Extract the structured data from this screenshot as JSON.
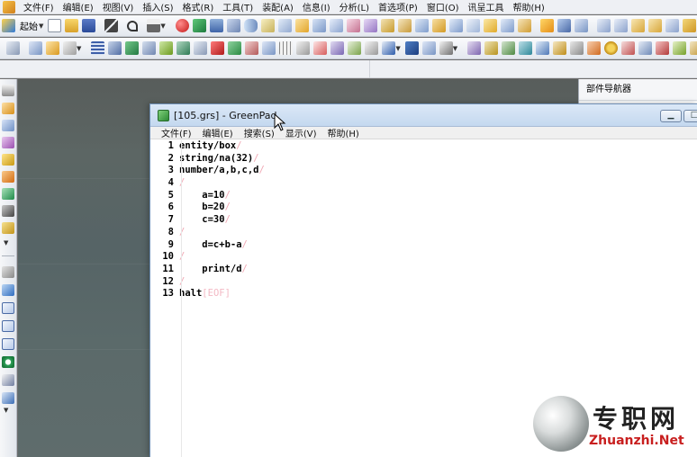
{
  "app": {
    "menu": [
      "文件(F)",
      "编辑(E)",
      "视图(V)",
      "插入(S)",
      "格式(R)",
      "工具(T)",
      "装配(A)",
      "信息(I)",
      "分析(L)",
      "首选项(P)",
      "窗口(O)",
      "讯呈工具",
      "帮助(H)"
    ]
  },
  "toolbar1": {
    "start_label": "起始"
  },
  "right_panel": {
    "title": "部件导航器"
  },
  "greenpad": {
    "title": "[105.grs] - GreenPad",
    "menu": [
      "文件(F)",
      "编辑(E)",
      "搜索(S)",
      "显示(V)",
      "帮助(H)"
    ],
    "window_buttons": {
      "minimize": "▁",
      "maximize": "□"
    },
    "lines": [
      {
        "no": "1",
        "code": "entity/box"
      },
      {
        "no": "2",
        "code": "string/na(32)"
      },
      {
        "no": "3",
        "code": "number/a,b,c,d"
      },
      {
        "no": "4",
        "code": ""
      },
      {
        "no": "5",
        "code": "    a=10"
      },
      {
        "no": "6",
        "code": "    b=20"
      },
      {
        "no": "7",
        "code": "    c=30"
      },
      {
        "no": "8",
        "code": ""
      },
      {
        "no": "9",
        "code": "    d=c+b-a"
      },
      {
        "no": "10",
        "code": ""
      },
      {
        "no": "11",
        "code": "    print/d"
      },
      {
        "no": "12",
        "code": ""
      },
      {
        "no": "13",
        "code": "halt"
      }
    ],
    "eol_marker": "/",
    "eof_marker": "[EOF]"
  },
  "watermark": {
    "cn": "专职网",
    "en": "Zhuanzhi.Net"
  },
  "colors": {
    "accent_window": "#c4d8ef",
    "canvas": "#5b6666",
    "eol_marker": "#f0a8b4",
    "watermark_red": "#c81f1f"
  }
}
